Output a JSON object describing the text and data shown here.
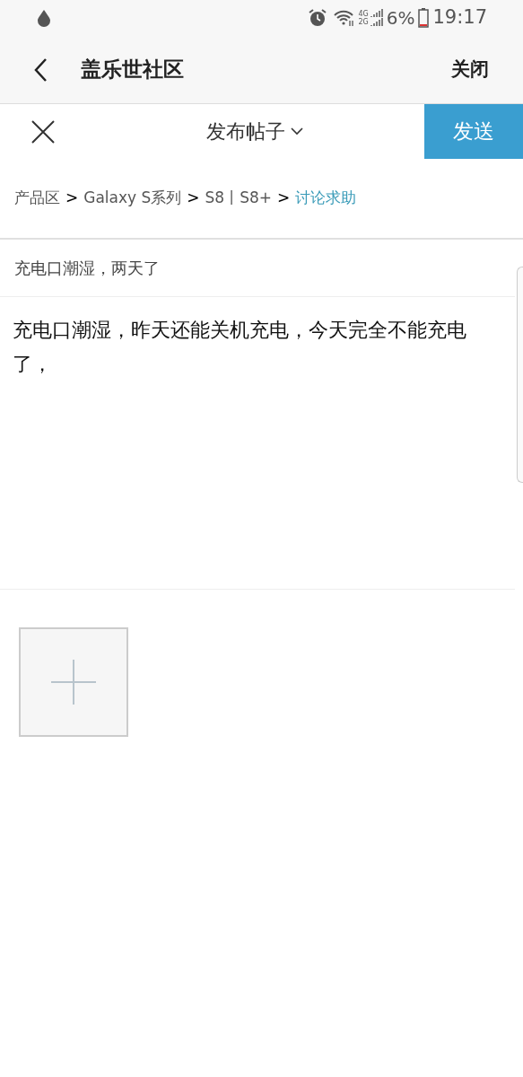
{
  "status_bar": {
    "network_top": "4G",
    "network_bottom": "2G",
    "battery": "6%",
    "time": "19:17"
  },
  "app_bar": {
    "title": "盖乐世社区",
    "close": "关闭"
  },
  "compose_bar": {
    "title": "发布帖子",
    "send": "发送"
  },
  "breadcrumb_separator": ">",
  "breadcrumb": [
    {
      "label": "产品区",
      "current": false
    },
    {
      "label": "Galaxy S系列",
      "current": false
    },
    {
      "label": "S8丨S8+",
      "current": false
    },
    {
      "label": "讨论求助",
      "current": true
    }
  ],
  "subject": {
    "value": "充电口潮湿，两天了"
  },
  "body": {
    "value": "充电口潮湿，昨天还能关机充电，今天完全不能充电了，"
  }
}
